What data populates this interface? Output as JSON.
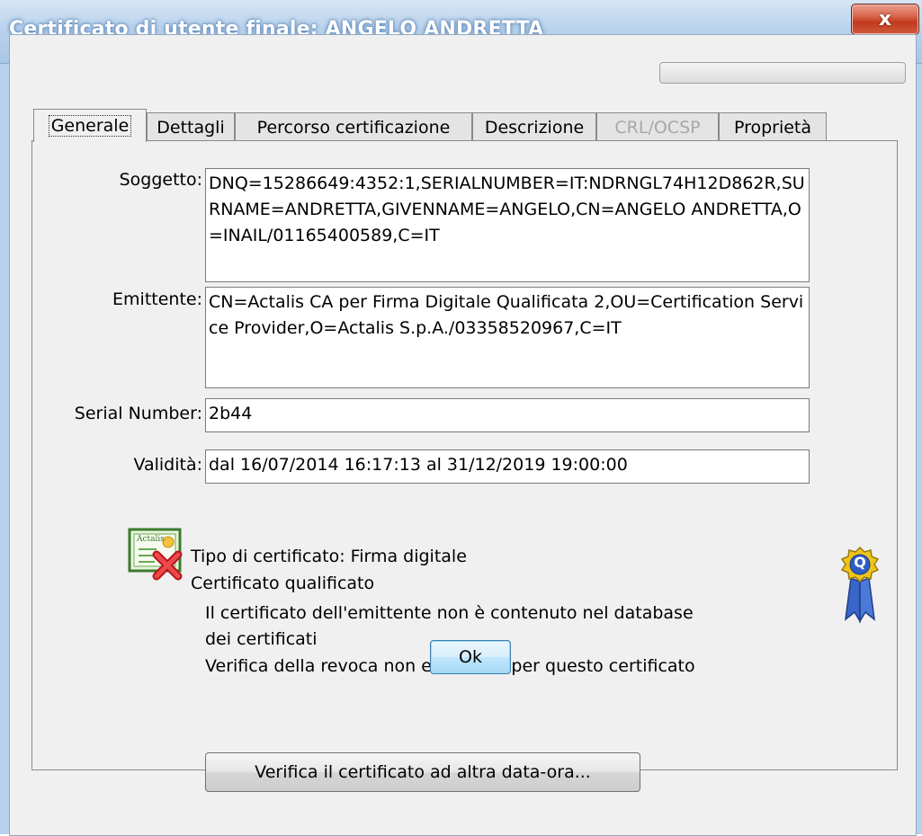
{
  "window": {
    "title": "Certificato di utente finale: ANGELO ANDRETTA",
    "close_label": "x"
  },
  "tabs": [
    {
      "label": "Generale",
      "state": "active"
    },
    {
      "label": "Dettagli",
      "state": "normal"
    },
    {
      "label": "Percorso certificazione",
      "state": "normal"
    },
    {
      "label": "Descrizione",
      "state": "normal"
    },
    {
      "label": "CRL/OCSP",
      "state": "disabled"
    },
    {
      "label": "Proprietà",
      "state": "normal"
    }
  ],
  "fields": {
    "soggetto": {
      "label": "Soggetto:",
      "value": "DNQ=15286649:4352:1,SERIALNUMBER=IT:NDRNGL74H12D862R,SURNAME=ANDRETTA,GIVENNAME=ANGELO,CN=ANGELO ANDRETTA,O=INAIL/01165400589,C=IT"
    },
    "emittente": {
      "label": "Emittente:",
      "value": "CN=Actalis CA per Firma Digitale Qualificata 2,OU=Certification Service Provider,O=Actalis S.p.A./03358520967,C=IT"
    },
    "serial": {
      "label": "Serial Number:",
      "value": "2b44"
    },
    "validita": {
      "label": "Validità:",
      "value": "dal 16/07/2014 16:17:13 al 31/12/2019 19:00:00"
    }
  },
  "info": {
    "icon_logo_text": "Actalis",
    "lines": [
      "Tipo di certificato: Firma digitale",
      "Certificato qualificato",
      "Il certificato dell'emittente non è contenuto nel database",
      "dei certificati",
      "Verifica della revoca non effettuata per questo certificato"
    ],
    "badge_letter": "Q"
  },
  "buttons": {
    "verify": "Verifica il certificato ad altra data-ora...",
    "ok": "Ok"
  },
  "icons": {
    "certificate": "certificate-invalid-icon",
    "qualified": "qualified-ribbon-icon"
  },
  "colors": {
    "title_bar": "#b9d1ea",
    "close_button": "#c13a1d",
    "disabled_text": "#a8a8a8"
  }
}
